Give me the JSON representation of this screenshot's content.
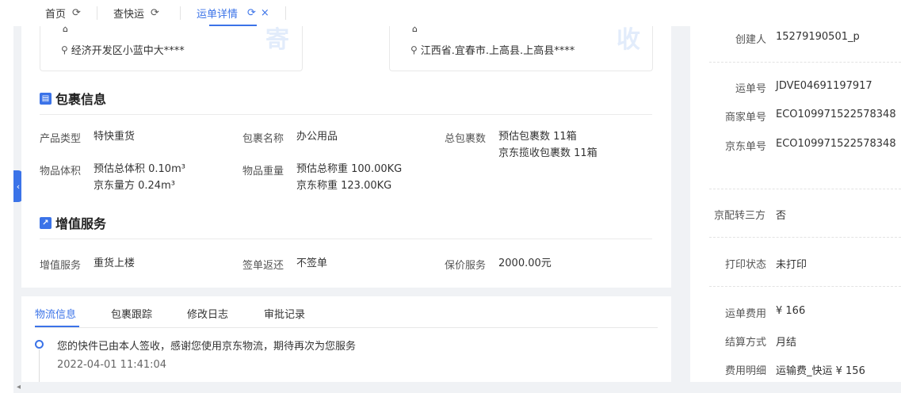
{
  "tabs": [
    {
      "label": "首页",
      "active": false
    },
    {
      "label": "查快运",
      "active": false
    },
    {
      "label": "运单详情",
      "active": true
    }
  ],
  "icons": {
    "refresh": "⟳",
    "close": "×",
    "collapse": "‹",
    "pin": "⚲",
    "building": "⌂",
    "scroll_left": "◂"
  },
  "sender": {
    "address": "经济开发区小蓝中大****",
    "stamp": "寄"
  },
  "receiver": {
    "address": "江西省.宜春市.上高县.上高县****",
    "stamp": "收"
  },
  "package_section": {
    "title": "包裹信息",
    "product_type_label": "产品类型",
    "product_type_value": "特快重货",
    "package_name_label": "包裹名称",
    "package_name_value": "办公用品",
    "total_packages_label": "总包裹数",
    "total_packages_line1": "预估包裹数 11箱",
    "total_packages_line2": "京东揽收包裹数 11箱",
    "volume_label": "物品体积",
    "volume_line1": "预估总体积 0.10m³",
    "volume_line2": "京东量方 0.24m³",
    "weight_label": "物品重量",
    "weight_line1": "预估总称重 100.00KG",
    "weight_line2": "京东称重 123.00KG"
  },
  "value_added_section": {
    "title": "增值服务",
    "service_label": "增值服务",
    "service_value": "重货上楼",
    "sign_return_label": "签单返还",
    "sign_return_value": "不签单",
    "insurance_label": "保价服务",
    "insurance_value": "2000.00元"
  },
  "logistics": {
    "tabs": [
      "物流信息",
      "包裹跟踪",
      "修改日志",
      "审批记录"
    ],
    "entry_message": "您的快件已由本人签收，感谢您使用京东物流，期待再次为您服务",
    "entry_time": "2022-04-01 11:41:04"
  },
  "right_panel": {
    "creator_label": "创建人",
    "creator_value": "15279190501_p",
    "waybill_label": "运单号",
    "waybill_value": "JDVE04691197917",
    "merchant_no_label": "商家单号",
    "merchant_no_value": "ECO109971522578348",
    "jd_no_label": "京东单号",
    "jd_no_value": "ECO109971522578348",
    "third_party_label": "京配转三方",
    "third_party_value": "否",
    "print_status_label": "打印状态",
    "print_status_value": "未打印",
    "fee_label": "运单费用",
    "fee_value": "¥ 166",
    "settlement_label": "结算方式",
    "settlement_value": "月结",
    "fee_detail_label": "费用明细",
    "fee_detail_value": "运输费_快运 ¥ 156"
  },
  "colors": {
    "accent": "#3b73e8",
    "stamp": "#e2ecfb"
  }
}
